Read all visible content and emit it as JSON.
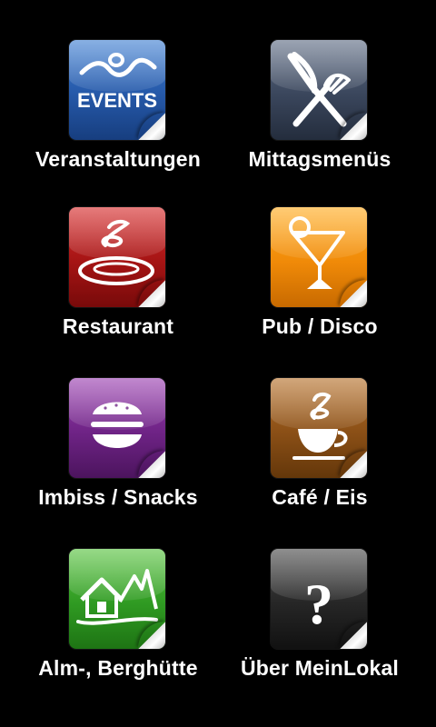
{
  "menu": {
    "items": [
      {
        "id": "events",
        "label": "Veranstaltungen",
        "icon": "events-icon",
        "color": "#2558a8",
        "icon_text": "EVENTS"
      },
      {
        "id": "lunch",
        "label": "Mittagsmenüs",
        "icon": "fork-knife-icon",
        "color": "#3a465c"
      },
      {
        "id": "restaurant",
        "label": "Restaurant",
        "icon": "steaming-plate-icon",
        "color": "#a51414"
      },
      {
        "id": "pub",
        "label": "Pub / Disco",
        "icon": "cocktail-icon",
        "color": "#f08a08"
      },
      {
        "id": "snacks",
        "label": "Imbiss / Snacks",
        "icon": "burger-icon",
        "color": "#6e2385"
      },
      {
        "id": "cafe",
        "label": "Café / Eis",
        "icon": "coffee-cup-icon",
        "color": "#8a4f16"
      },
      {
        "id": "hut",
        "label": "Alm-, Berghütte",
        "icon": "mountain-hut-icon",
        "color": "#2f9a22"
      },
      {
        "id": "about",
        "label": "Über MeinLokal",
        "icon": "question-mark-icon",
        "color": "#262626",
        "icon_text": "?"
      }
    ]
  }
}
